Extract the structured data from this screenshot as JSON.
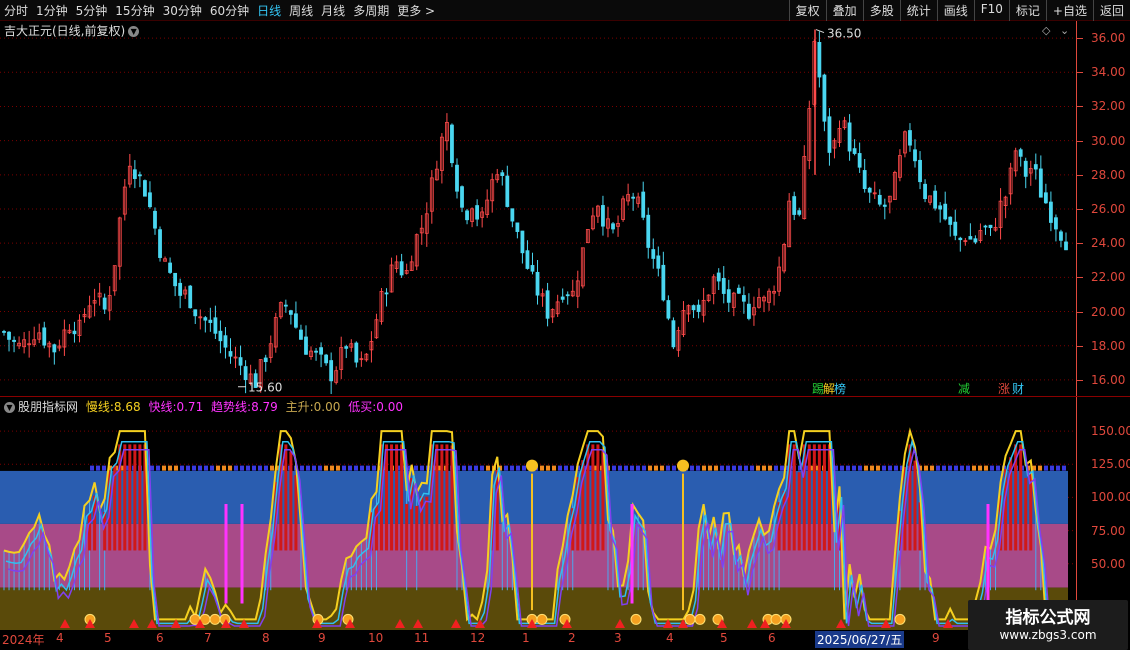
{
  "toolbar": {
    "periods": [
      "分时",
      "1分钟",
      "5分钟",
      "15分钟",
      "30分钟",
      "60分钟",
      "日线",
      "周线",
      "月线",
      "多周期",
      "更多 >"
    ],
    "active_period": 6,
    "tools": [
      "复权",
      "叠加",
      "多股",
      "统计",
      "画线",
      "F10",
      "标记",
      "+自选",
      "返回"
    ]
  },
  "stock": {
    "title": "吉大正元(日线,前复权)",
    "high_label": "36.50",
    "low_label": "15.60"
  },
  "price_axis": [
    "36.00",
    "34.00",
    "32.00",
    "30.00",
    "28.00",
    "26.00",
    "24.00",
    "22.00",
    "20.00",
    "18.00",
    "16.00"
  ],
  "price_tags": [
    {
      "text": "踢",
      "color": "#22cc33"
    },
    {
      "text": "解",
      "color": "#f5d020"
    },
    {
      "text": "榜",
      "color": "#34c6f4"
    },
    {
      "text": "减",
      "color": "#22cc33"
    },
    {
      "text": "涨",
      "color": "#e0483c"
    },
    {
      "text": "财",
      "color": "#34c6f4"
    }
  ],
  "indicator": {
    "name": "股朋指标网",
    "slow_label": "慢线:",
    "slow_value": "8.68",
    "fast_label": "快线:",
    "fast_value": "0.71",
    "trend_label": "趋势线:",
    "trend_value": "8.79",
    "rise_label": "主升:",
    "rise_value": "0.00",
    "low_label": "低买:",
    "low_value": "0.00",
    "colors": {
      "slow": "#f5d020",
      "fast": "#ff33ff",
      "trend": "#ff33ff",
      "rise": "#c8a850",
      "low": "#ff33ff"
    }
  },
  "ind_axis": [
    "150.00",
    "125.00",
    "100.00",
    "75.00",
    "50.00"
  ],
  "dates": [
    "2024年",
    "4",
    "5",
    "6",
    "7",
    "8",
    "9",
    "10",
    "11",
    "12",
    "1",
    "2",
    "3",
    "4",
    "5",
    "6",
    "9"
  ],
  "selected_date": "2025/06/27/五",
  "watermark": {
    "line1": "指标公式网",
    "line2": "www.zbgs3.com"
  },
  "chart_data": {
    "type": "candlestick",
    "title": "吉大正元(日线,前复权)",
    "ylim": [
      15,
      37
    ],
    "marked_high": 36.5,
    "marked_low": 15.6,
    "close_path": [
      18.8,
      18.2,
      17.9,
      18.5,
      19.0,
      18.3,
      17.8,
      18.6,
      19.5,
      18.9,
      20.5,
      21.0,
      20.0,
      22.0,
      26.0,
      29.0,
      28.0,
      27.0,
      25.0,
      23.0,
      22.0,
      21.0,
      21.0,
      20.0,
      19.5,
      19.0,
      18.2,
      17.5,
      17.0,
      16.5,
      15.8,
      17.0,
      18.5,
      20.0,
      20.5,
      19.0,
      18.0,
      17.5,
      17.0,
      16.3,
      17.0,
      18.2,
      17.0,
      16.8,
      18.5,
      20.5,
      22.0,
      23.0,
      22.0,
      24.0,
      25.0,
      27.0,
      29.5,
      31.0,
      28.0,
      25.5,
      26.5,
      25.0,
      27.0,
      28.5,
      27.0,
      25.0,
      23.5,
      22.0,
      21.0,
      20.0,
      20.5,
      21.5,
      21.0,
      23.0,
      25.5,
      26.5,
      25.0,
      24.5,
      26.0,
      27.0,
      26.0,
      24.0,
      22.5,
      21.0,
      18.0,
      20.0,
      21.0,
      19.5,
      21.0,
      22.0,
      21.0,
      20.5,
      20.5,
      20.0,
      21.0,
      20.5,
      21.5,
      23.0,
      27.0,
      25.0,
      30.0,
      36.5,
      31.0,
      29.0,
      31.5,
      30.0,
      28.5,
      27.0,
      26.5,
      26.0,
      26.5,
      28.5,
      30.5,
      29.0,
      27.0,
      26.5,
      26.0,
      25.0,
      24.0,
      24.5,
      24.0,
      25.0,
      24.5,
      26.0,
      27.0,
      29.5,
      28.0,
      28.5,
      27.0,
      26.0,
      25.0,
      24.2
    ]
  }
}
